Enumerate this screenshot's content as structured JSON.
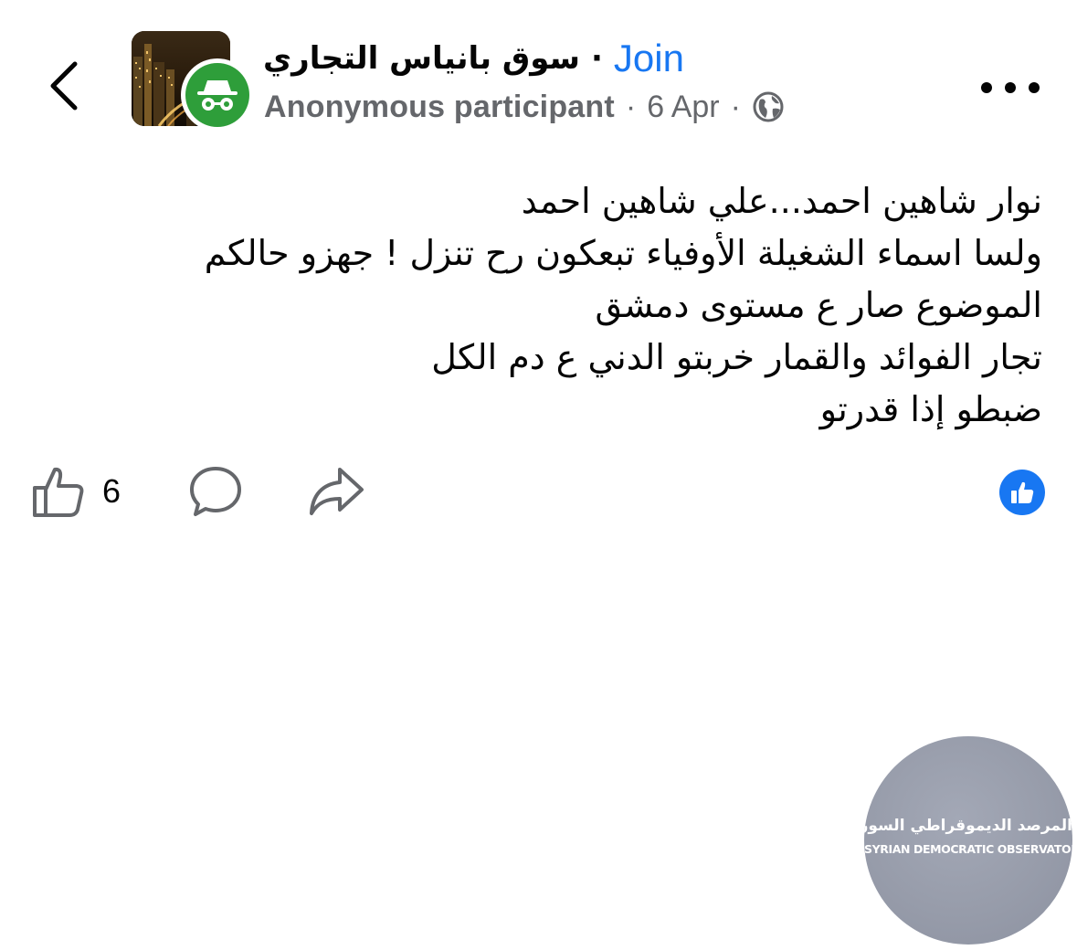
{
  "header": {
    "group_name": "سوق بانياس التجاري",
    "separator": "·",
    "join_label": "Join",
    "author": "Anonymous participant",
    "meta_separator": "·",
    "date": "6 Apr",
    "privacy_icon": "globe-icon",
    "back_icon": "chevron-left-icon",
    "more_icon": "more-horizontal-icon",
    "anonymous_icon": "incognito-icon"
  },
  "post": {
    "lines": [
      "نوار شاهين احمد...علي شاهين احمد",
      "ولسا اسماء الشغيلة الأوفياء تبعكون رح تنزل ! جهزو حالكم",
      "الموضوع صار ع مستوى دمشق",
      "تجار الفوائد والقمار خربتو الدني ع دم الكل",
      "ضبطو إذا قدرتو"
    ]
  },
  "actions": {
    "like_icon": "thumbs-up-outline-icon",
    "like_count": "6",
    "comment_icon": "comment-bubble-icon",
    "share_icon": "share-arrow-icon",
    "reaction_icon": "like-reaction-icon"
  },
  "watermark": {
    "arabic": "المرصد الديموقراطي السوري",
    "english": "SYRIAN DEMOCRATIC OBSERVATORY"
  },
  "colors": {
    "accent": "#1877f2",
    "secondary_text": "#65676b",
    "anonymous_badge": "#2e9e3a",
    "text": "#050505"
  }
}
